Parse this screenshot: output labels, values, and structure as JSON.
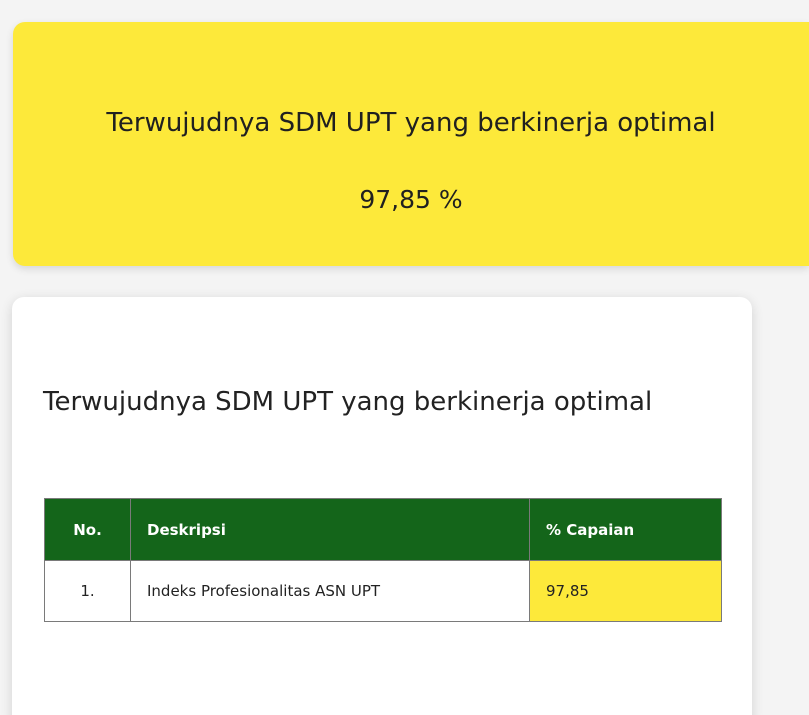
{
  "summary": {
    "title": "Terwujudnya SDM UPT yang berkinerja optimal",
    "value": "97,85 %"
  },
  "detail": {
    "title": "Terwujudnya SDM UPT yang berkinerja optimal",
    "table": {
      "headers": [
        "No.",
        "Deskripsi",
        "% Capaian"
      ],
      "rows": [
        {
          "no": "1.",
          "deskripsi": "Indeks Profesionalitas ASN UPT",
          "capaian": "97,85"
        }
      ]
    }
  },
  "colors": {
    "accent_yellow": "#fde93a",
    "header_green": "#14651a"
  }
}
